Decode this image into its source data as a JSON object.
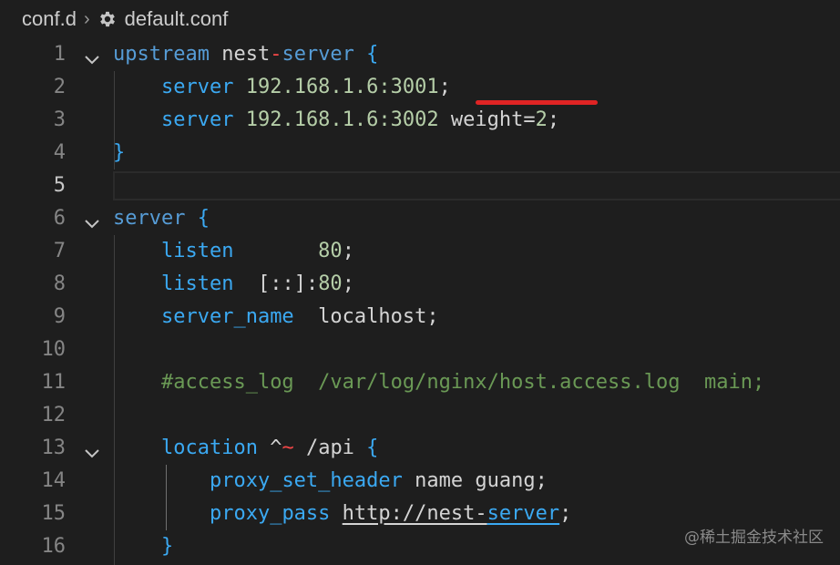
{
  "breadcrumb": {
    "folder": "conf.d",
    "separator": "›",
    "file": "default.conf"
  },
  "lines": [
    {
      "n": "1",
      "fold": true,
      "parts": [
        {
          "c": "kw",
          "t": "upstream"
        },
        {
          "c": "txt",
          "t": " nest"
        },
        {
          "c": "op",
          "t": "-"
        },
        {
          "c": "kw",
          "t": "server"
        },
        {
          "c": "brace",
          "t": " {"
        }
      ]
    },
    {
      "n": "2",
      "fold": false,
      "parts": [
        {
          "c": "txt",
          "t": "    "
        },
        {
          "c": "prop",
          "t": "server"
        },
        {
          "c": "num",
          "t": " 192.168.1.6:3001"
        },
        {
          "c": "txt",
          "t": ";"
        }
      ]
    },
    {
      "n": "3",
      "fold": false,
      "parts": [
        {
          "c": "txt",
          "t": "    "
        },
        {
          "c": "prop",
          "t": "server"
        },
        {
          "c": "num",
          "t": " 192.168.1.6:3002"
        },
        {
          "c": "txt",
          "t": " weight="
        },
        {
          "c": "num",
          "t": "2"
        },
        {
          "c": "txt",
          "t": ";"
        }
      ]
    },
    {
      "n": "4",
      "fold": false,
      "parts": [
        {
          "c": "brace",
          "t": "}"
        }
      ]
    },
    {
      "n": "5",
      "fold": false,
      "current": true,
      "parts": []
    },
    {
      "n": "6",
      "fold": true,
      "parts": [
        {
          "c": "kw",
          "t": "server"
        },
        {
          "c": "brace",
          "t": " {"
        }
      ]
    },
    {
      "n": "7",
      "fold": false,
      "parts": [
        {
          "c": "txt",
          "t": "    "
        },
        {
          "c": "prop",
          "t": "listen"
        },
        {
          "c": "num",
          "t": "       80"
        },
        {
          "c": "txt",
          "t": ";"
        }
      ]
    },
    {
      "n": "8",
      "fold": false,
      "parts": [
        {
          "c": "txt",
          "t": "    "
        },
        {
          "c": "prop",
          "t": "listen"
        },
        {
          "c": "txt",
          "t": "  [::]:"
        },
        {
          "c": "num",
          "t": "80"
        },
        {
          "c": "txt",
          "t": ";"
        }
      ]
    },
    {
      "n": "9",
      "fold": false,
      "parts": [
        {
          "c": "txt",
          "t": "    "
        },
        {
          "c": "prop",
          "t": "server_name"
        },
        {
          "c": "txt",
          "t": "  localhost;"
        }
      ]
    },
    {
      "n": "10",
      "fold": false,
      "parts": []
    },
    {
      "n": "11",
      "fold": false,
      "parts": [
        {
          "c": "txt",
          "t": "    "
        },
        {
          "c": "cmt",
          "t": "#access_log  /var/log/nginx/host.access.log  main;"
        }
      ]
    },
    {
      "n": "12",
      "fold": false,
      "parts": []
    },
    {
      "n": "13",
      "fold": true,
      "parts": [
        {
          "c": "txt",
          "t": "    "
        },
        {
          "c": "prop",
          "t": "location"
        },
        {
          "c": "txt",
          "t": " ^"
        },
        {
          "c": "op",
          "t": "~"
        },
        {
          "c": "txt",
          "t": " /api"
        },
        {
          "c": "brace",
          "t": " {"
        }
      ]
    },
    {
      "n": "14",
      "fold": false,
      "parts": [
        {
          "c": "txt",
          "t": "        "
        },
        {
          "c": "prop",
          "t": "proxy_set_header"
        },
        {
          "c": "txt",
          "t": " name guang;"
        }
      ]
    },
    {
      "n": "15",
      "fold": false,
      "parts": [
        {
          "c": "txt",
          "t": "        "
        },
        {
          "c": "prop",
          "t": "proxy_pass"
        },
        {
          "c": "txt",
          "t": " "
        },
        {
          "c": "txt u",
          "t": "http://nest-"
        },
        {
          "c": "prop u",
          "t": "server"
        },
        {
          "c": "txt",
          "t": ";"
        }
      ]
    },
    {
      "n": "16",
      "fold": false,
      "parts": [
        {
          "c": "txt",
          "t": "    "
        },
        {
          "c": "brace",
          "t": "}"
        }
      ]
    }
  ],
  "watermark": "@稀土掘金技术社区",
  "colors": {
    "background": "#1e1e1e",
    "keyword": "#569cd6",
    "number": "#b5cea8",
    "comment": "#6a9955",
    "highlight": "#e02424"
  },
  "icons": {
    "file": "gear-icon",
    "fold": "chevron-down-icon"
  }
}
